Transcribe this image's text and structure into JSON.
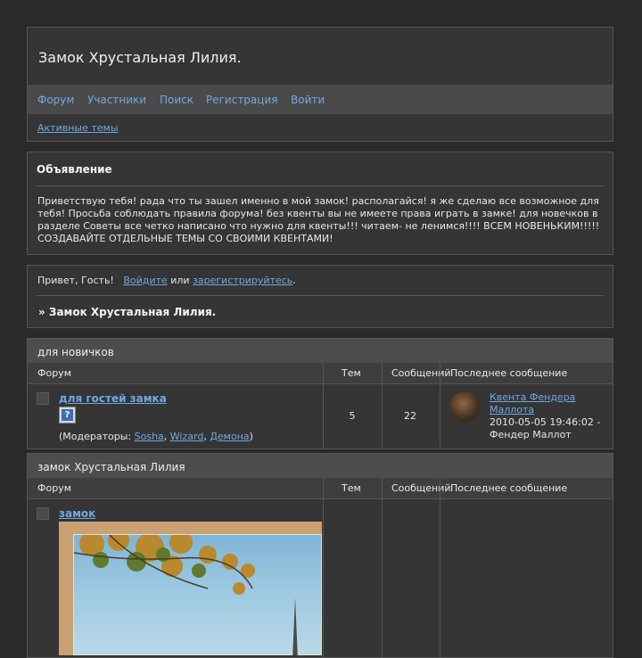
{
  "header": {
    "title": "Замок Хрустальная Лилия.",
    "nav": [
      "Форум",
      "Участники",
      "Поиск",
      "Регистрация",
      "Войти"
    ],
    "active_topics": "Активные темы"
  },
  "announcement": {
    "heading": "Объявление",
    "text": "Приветствую тебя! рада что ты зашел именно в мой замок! располагайся! я же сделаю все возможное для тебя! Просьба соблюдать правила форума! без квенты вы не имеете права играть в замке! для новечков в разделе Советы все четко написано что нужно для квенты!!! читаем- не ленимся!!!! ВСЕМ НОВЕНЬКИМ!!!!! СОЗДАВАЙТЕ ОТДЕЛЬНЫЕ ТЕМЫ СО СВОИМИ КВЕНТАМИ!"
  },
  "welcome": {
    "greeting": "Привет, Гость!",
    "login_link": "Войдите",
    "or": "или",
    "register_link": "зарегистрируйтесь",
    "period": ".",
    "crumb": "» Замок Хрустальная Лилия."
  },
  "columns": {
    "forum": "Форум",
    "topics": "Тем",
    "posts": "Сообщений",
    "last_post": "Последнее сообщение"
  },
  "categories": [
    {
      "name": "для новичков",
      "forum": {
        "title": "для гостей замка",
        "topics": "5",
        "posts": "22",
        "moderators_label": "(Модераторы: ",
        "moderators": [
          "Sosha",
          "Wizard",
          "Демона"
        ],
        "mods_close": ")",
        "last_post_title_1": "Квента Фендера",
        "last_post_title_2": "Маллота",
        "last_post_date": "2010-05-05 19:46:02 -",
        "last_post_author": "Фендер Маллот"
      }
    },
    {
      "name": "замок Хрустальная Лилия",
      "forum": {
        "title": "замок"
      }
    }
  ]
}
